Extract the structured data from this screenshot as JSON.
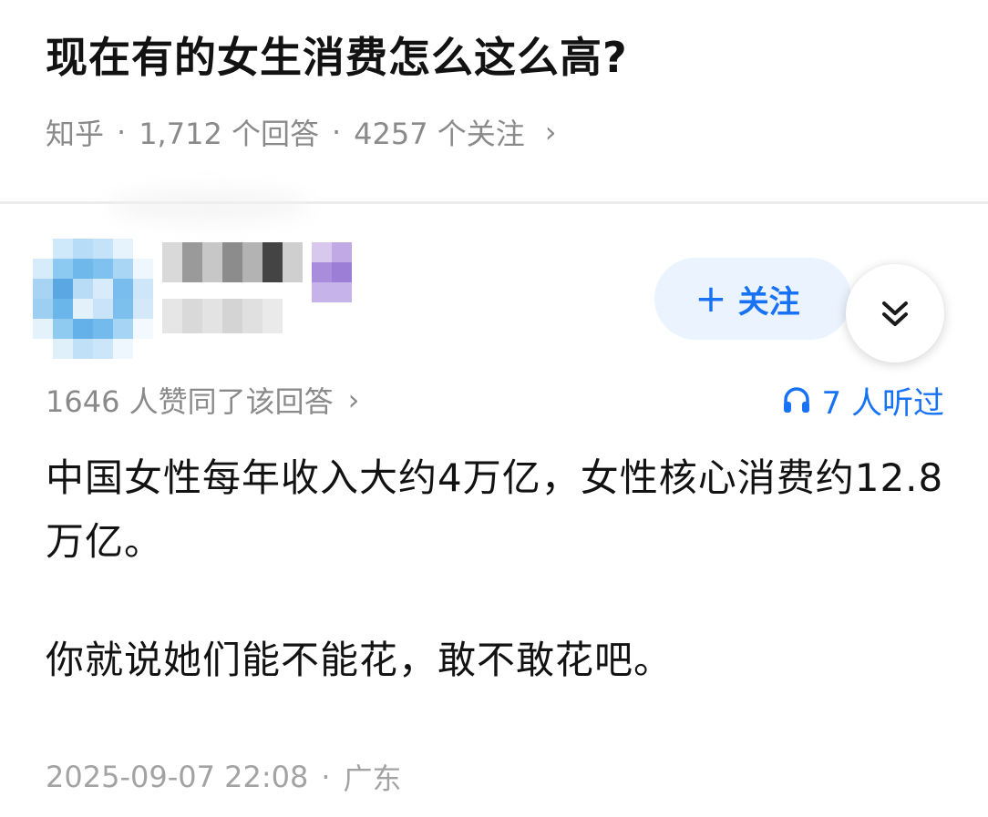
{
  "question": {
    "title": "现在有的女生消费怎么这么高?",
    "source": "知乎",
    "separator": "·",
    "answers_count": "1,712 个回答",
    "followers_count": "4257 个关注",
    "chevron": "›"
  },
  "author": {
    "avatar_icon": "avatar-pixelated",
    "follow_plus": "+",
    "follow_label": "关注",
    "expand_icon": "double-chevron-down-icon"
  },
  "answer": {
    "votes_text": "1646 人赞同了该回答",
    "chevron": "›",
    "listen_icon": "headphones-icon",
    "listen_text": "7 人听过",
    "paragraphs": [
      "中国女性每年收入大约4万亿，女性核心消费约12.8万亿。",
      "你就说她们能不能花，敢不敢花吧。"
    ],
    "date": "2025-09-07 22:08",
    "separator": "·",
    "location": "广东"
  },
  "colors": {
    "accent": "#1772f6",
    "follow_bg": "#ebf3fe",
    "meta_gray": "#8a8a8a",
    "title": "#121212"
  }
}
